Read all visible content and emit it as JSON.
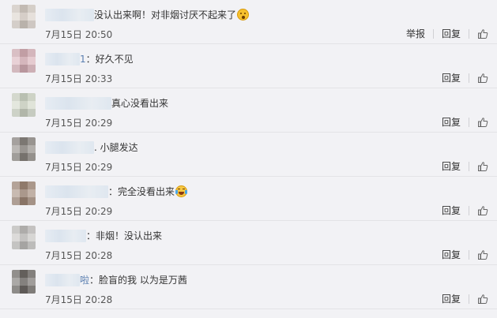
{
  "comments": [
    {
      "name_tail": "",
      "text": "没认出来啊！对非烟讨厌不起来了",
      "emoji": "surprised-emoji",
      "time": "7月15日 20:50",
      "report": "举报",
      "reply": "回复",
      "avatar": "#d9d0c8",
      "name_w": 62
    },
    {
      "name_tail": "1",
      "text": "：好久不见",
      "emoji": "",
      "time": "7月15日 20:33",
      "report": "",
      "reply": "回复",
      "avatar": "#d8b0b8",
      "name_w": 44
    },
    {
      "name_tail": "",
      "text": "真心没看出来",
      "emoji": "",
      "time": "7月15日 20:29",
      "report": "",
      "reply": "回复",
      "avatar": "#cfd6c6",
      "name_w": 84
    },
    {
      "name_tail": "",
      "text": ". 小腿发达",
      "emoji": "",
      "time": "7月15日 20:29",
      "report": "",
      "reply": "回复",
      "avatar": "#8a8580",
      "name_w": 62
    },
    {
      "name_tail": "",
      "text": "：完全没看出来",
      "emoji": "laughing-tears-emoji",
      "time": "7月15日 20:29",
      "report": "",
      "reply": "回复",
      "avatar": "#a08878",
      "name_w": 80
    },
    {
      "name_tail": "",
      "text": "：非烟！没认出来",
      "emoji": "",
      "time": "7月15日 20:28",
      "report": "",
      "reply": "回复",
      "avatar": "#c2c0be",
      "name_w": 52
    },
    {
      "name_tail": "啦",
      "text": "：脸盲的我 以为是万茜",
      "emoji": "",
      "time": "7月15日 20:28",
      "report": "",
      "reply": "回复",
      "avatar": "#6e6a66",
      "name_w": 44
    }
  ]
}
